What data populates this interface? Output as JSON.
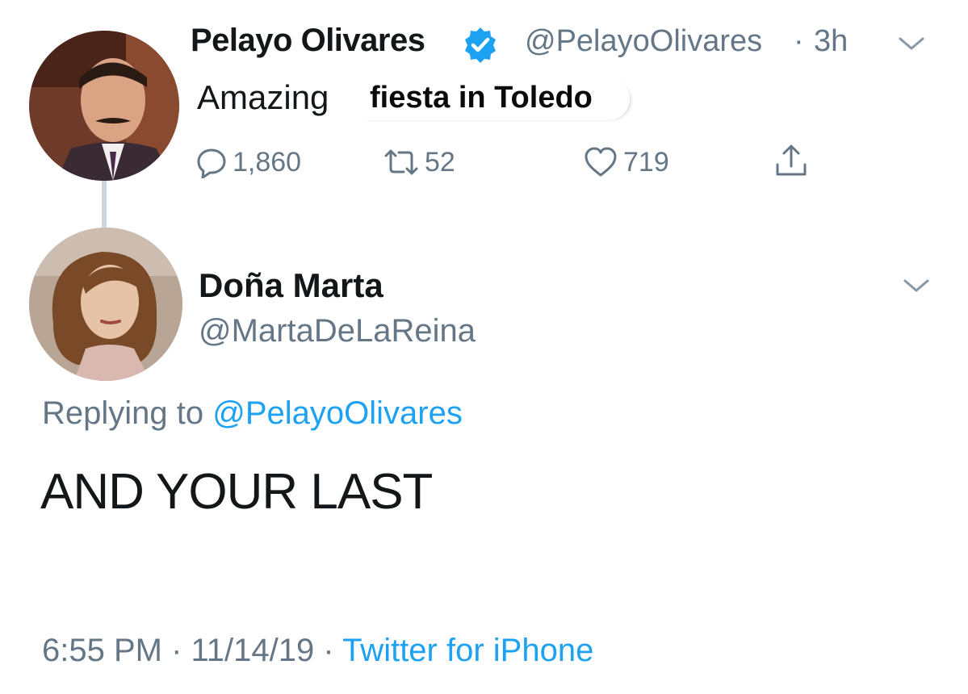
{
  "tweet1": {
    "author_name": "Pelayo Olivares",
    "verified_icon": "verified-badge-icon",
    "handle": "@PelayoOlivares",
    "separator": "·",
    "time": "3h",
    "text_part1": "Amazing",
    "text_part2": "fiesta in Toledo",
    "actions": {
      "reply_count": "1,860",
      "retweet_count": "52",
      "like_count": "719"
    }
  },
  "tweet2": {
    "author_name": "Doña Marta",
    "handle": "@MartaDeLaReina",
    "replying_prefix": "Replying to",
    "replying_to": "@PelayoOlivares",
    "text": "AND YOUR LAST",
    "time": "6:55 PM",
    "sep1": " · ",
    "date": "11/14/19",
    "sep2": " · ",
    "source": "Twitter for iPhone"
  },
  "colors": {
    "text_primary": "#14171a",
    "text_secondary": "#657786",
    "link": "#1da1f2",
    "verified": "#1da1f2",
    "thread_line": "#cfd6dc"
  }
}
